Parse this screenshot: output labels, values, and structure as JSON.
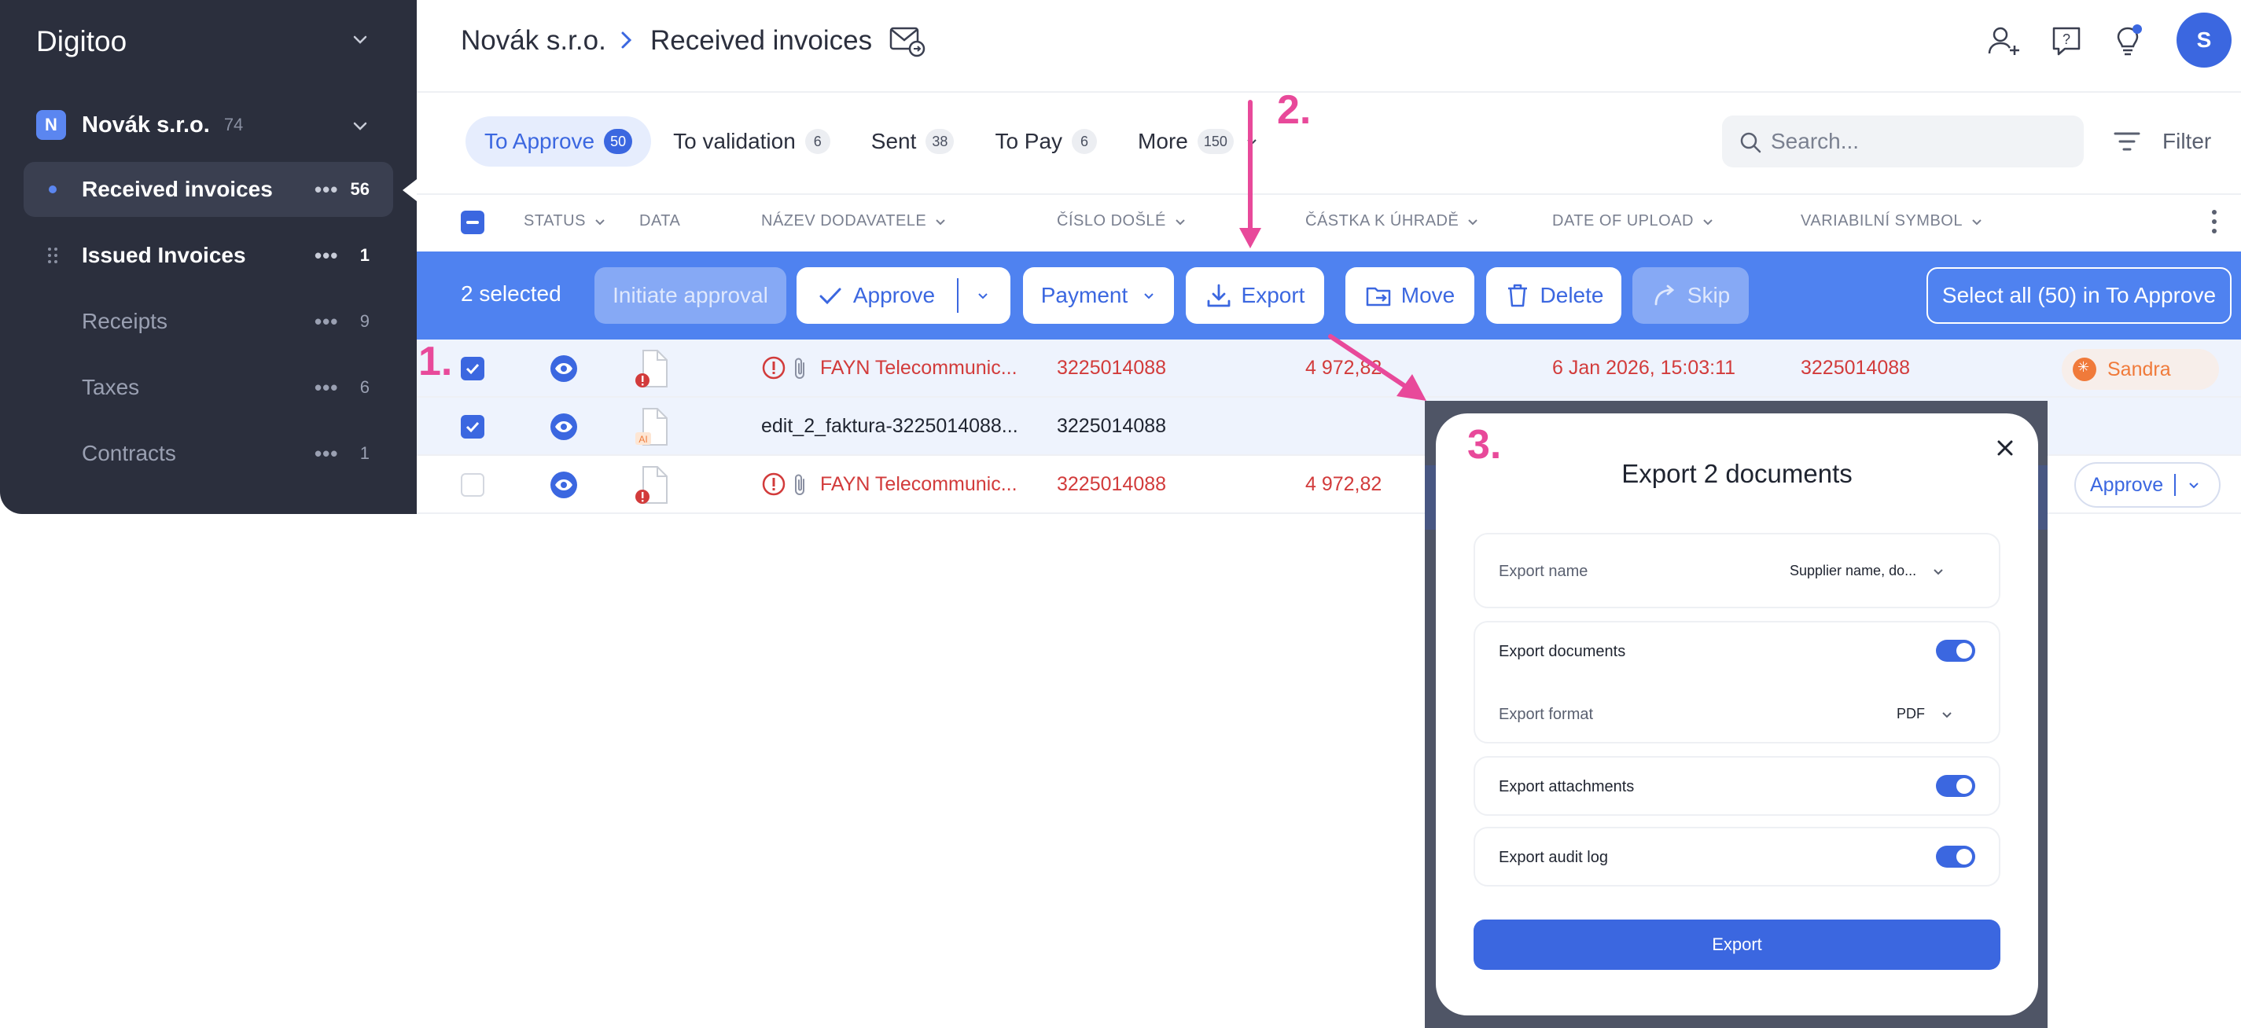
{
  "sidebar": {
    "brand": "Digitoo",
    "org": {
      "badge": "N",
      "name": "Novák s.r.o.",
      "count": "74"
    },
    "items": [
      {
        "label": "Received invoices",
        "count": "56"
      },
      {
        "label": "Issued Invoices",
        "count": "1"
      },
      {
        "label": "Receipts",
        "count": "9"
      },
      {
        "label": "Taxes",
        "count": "6"
      },
      {
        "label": "Contracts",
        "count": "1"
      }
    ]
  },
  "header": {
    "company": "Novák s.r.o.",
    "page": "Received invoices",
    "avatar": "S"
  },
  "tabs": [
    {
      "label": "To Approve",
      "count": "50"
    },
    {
      "label": "To validation",
      "count": "6"
    },
    {
      "label": "Sent",
      "count": "38"
    },
    {
      "label": "To Pay",
      "count": "6"
    },
    {
      "label": "More",
      "count": "150"
    }
  ],
  "search": {
    "placeholder": "Search..."
  },
  "filter_label": "Filter",
  "columns": {
    "status": "STATUS",
    "data": "DATA",
    "supplier": "NÁZEV DODAVATELE",
    "received_no": "ČÍSLO DOŠLÉ",
    "amount": "ČÁSTKA K ÚHRADĚ",
    "upload_date": "DATE OF UPLOAD",
    "var_symbol": "VARIABILNÍ SYMBOL"
  },
  "actionbar": {
    "selected": "2 selected",
    "initiate": "Initiate approval",
    "approve": "Approve",
    "payment": "Payment",
    "export": "Export",
    "move": "Move",
    "delete": "Delete",
    "skip": "Skip",
    "select_all": "Select all (50) in To Approve"
  },
  "rows": [
    {
      "supplier": "FAYN Telecommunic...",
      "received_no": "3225014088",
      "amount": "4 972,82",
      "upload_date": "6 Jan 2026, 15:03:11",
      "var_symbol": "3225014088",
      "assignee": "Sandra"
    },
    {
      "supplier": "edit_2_faktura-3225014088...",
      "received_no": "3225014088",
      "doc_tag": "AI"
    },
    {
      "supplier": "FAYN Telecommunic...",
      "received_no": "3225014088",
      "amount": "4 972,82",
      "action": "Approve"
    }
  ],
  "modal": {
    "title": "Export 2 documents",
    "export_name_label": "Export name",
    "export_name_value": "Supplier name, do...",
    "export_documents": "Export documents",
    "export_format_label": "Export format",
    "export_format_value": "PDF",
    "export_attachments": "Export attachments",
    "export_audit_log": "Export audit log",
    "button": "Export"
  },
  "annotations": {
    "one": "1.",
    "two": "2.",
    "three": "3."
  },
  "colors": {
    "accent": "#3b67e0",
    "actionbar": "#4f82f0",
    "sidebar": "#2b2f3d",
    "danger": "#d23b3b",
    "annotation": "#e8499a"
  }
}
